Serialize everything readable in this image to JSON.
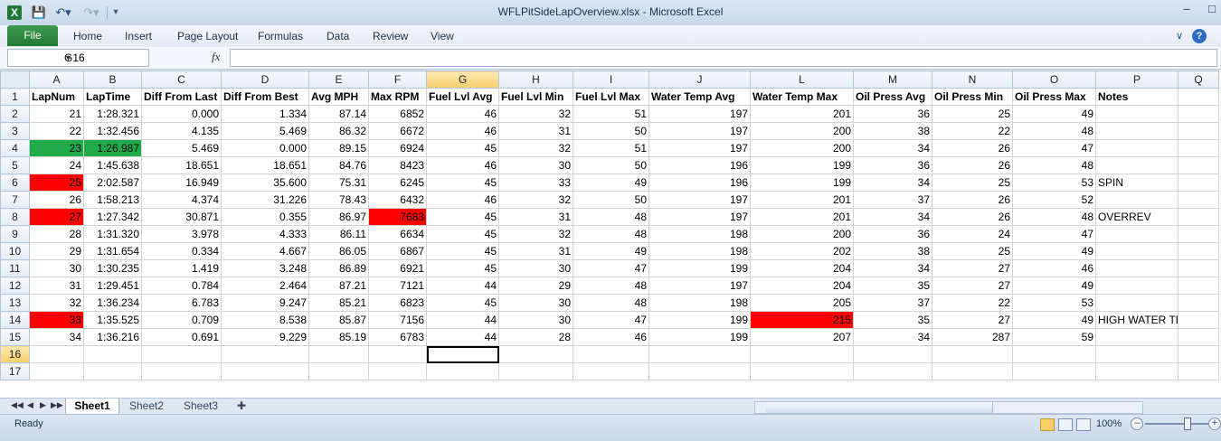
{
  "window": {
    "title": "WFLPitSideLapOverview.xlsx  -  Microsoft Excel",
    "app_icon": "excel-icon",
    "quick_access": [
      "save-icon",
      "undo-icon",
      "redo-icon",
      "customize-icon"
    ]
  },
  "ribbon": {
    "file_label": "File",
    "tabs": [
      "Home",
      "Insert",
      "Page Layout",
      "Formulas",
      "Data",
      "Review",
      "View"
    ]
  },
  "formula_bar": {
    "name_box": "G16",
    "fx_label": "fx",
    "content": ""
  },
  "grid": {
    "columns": [
      "A",
      "B",
      "C",
      "D",
      "E",
      "F",
      "G",
      "H",
      "I",
      "J",
      "L",
      "M",
      "N",
      "O",
      "P",
      "Q"
    ],
    "selected_column": "G",
    "selected_row": "16",
    "row_numbers": [
      "1",
      "2",
      "3",
      "4",
      "5",
      "6",
      "7",
      "8",
      "9",
      "10",
      "11",
      "12",
      "13",
      "14",
      "15",
      "16",
      "17"
    ],
    "header_row": [
      "LapNum",
      "LapTime",
      "Diff From Last",
      "Diff From Best",
      "Avg MPH",
      "Max RPM",
      "Fuel Lvl Avg",
      "Fuel Lvl Min",
      "Fuel Lvl Max",
      "Water Temp Avg",
      "Water Temp Max",
      "Oil Press Avg",
      "Oil Press Min",
      "Oil Press Max",
      "Notes",
      ""
    ],
    "rows": [
      [
        "21",
        "1:28.321",
        "0.000",
        "1.334",
        "87.14",
        "6852",
        "46",
        "32",
        "51",
        "197",
        "201",
        "36",
        "25",
        "49",
        "",
        ""
      ],
      [
        "22",
        "1:32.456",
        "4.135",
        "5.469",
        "86.32",
        "6672",
        "46",
        "31",
        "50",
        "197",
        "200",
        "38",
        "22",
        "48",
        "",
        ""
      ],
      [
        "23",
        "1:26.987",
        "5.469",
        "0.000",
        "89.15",
        "6924",
        "45",
        "32",
        "51",
        "197",
        "200",
        "34",
        "26",
        "47",
        "",
        ""
      ],
      [
        "24",
        "1:45.638",
        "18.651",
        "18.651",
        "84.76",
        "8423",
        "46",
        "30",
        "50",
        "196",
        "199",
        "36",
        "26",
        "48",
        "",
        ""
      ],
      [
        "25",
        "2:02.587",
        "16.949",
        "35.600",
        "75.31",
        "6245",
        "45",
        "33",
        "49",
        "196",
        "199",
        "34",
        "25",
        "53",
        "SPIN",
        ""
      ],
      [
        "26",
        "1:58.213",
        "4.374",
        "31.226",
        "78.43",
        "6432",
        "46",
        "32",
        "50",
        "197",
        "201",
        "37",
        "26",
        "52",
        "",
        ""
      ],
      [
        "27",
        "1:27.342",
        "30.871",
        "0.355",
        "86.97",
        "7683",
        "45",
        "31",
        "48",
        "197",
        "201",
        "34",
        "26",
        "48",
        "OVERREV",
        ""
      ],
      [
        "28",
        "1:31.320",
        "3.978",
        "4.333",
        "86.11",
        "6634",
        "45",
        "32",
        "48",
        "198",
        "200",
        "36",
        "24",
        "47",
        "",
        ""
      ],
      [
        "29",
        "1:31.654",
        "0.334",
        "4.667",
        "86.05",
        "6867",
        "45",
        "31",
        "49",
        "198",
        "202",
        "38",
        "25",
        "49",
        "",
        ""
      ],
      [
        "30",
        "1:30.235",
        "1.419",
        "3.248",
        "86.89",
        "6921",
        "45",
        "30",
        "47",
        "199",
        "204",
        "34",
        "27",
        "46",
        "",
        ""
      ],
      [
        "31",
        "1:29.451",
        "0.784",
        "2.464",
        "87.21",
        "7121",
        "44",
        "29",
        "48",
        "197",
        "204",
        "35",
        "27",
        "49",
        "",
        ""
      ],
      [
        "32",
        "1:36.234",
        "6.783",
        "9.247",
        "85.21",
        "6823",
        "45",
        "30",
        "48",
        "198",
        "205",
        "37",
        "22",
        "53",
        "",
        ""
      ],
      [
        "33",
        "1:35.525",
        "0.709",
        "8.538",
        "85.87",
        "7156",
        "44",
        "30",
        "47",
        "199",
        "215",
        "35",
        "27",
        "49",
        "HIGH WATER TEMP",
        ""
      ],
      [
        "34",
        "1:36.216",
        "0.691",
        "9.229",
        "85.19",
        "6783",
        "44",
        "28",
        "46",
        "199",
        "207",
        "34",
        "287",
        "59",
        "",
        ""
      ]
    ],
    "highlights": [
      {
        "row": 2,
        "col": 0,
        "color": "#1fab4a"
      },
      {
        "row": 2,
        "col": 1,
        "color": "#1fab4a"
      },
      {
        "row": 4,
        "col": 0,
        "color": "#ff0000"
      },
      {
        "row": 6,
        "col": 0,
        "color": "#ff0000"
      },
      {
        "row": 6,
        "col": 5,
        "color": "#ff0000"
      },
      {
        "row": 12,
        "col": 0,
        "color": "#ff0000"
      },
      {
        "row": 12,
        "col": 10,
        "color": "#ff0000"
      }
    ]
  },
  "sheets": [
    "Sheet1",
    "Sheet2",
    "Sheet3"
  ],
  "active_sheet": "Sheet1",
  "status": {
    "text": "Ready",
    "zoom": "100%",
    "zoom_fraction": 0.5
  }
}
